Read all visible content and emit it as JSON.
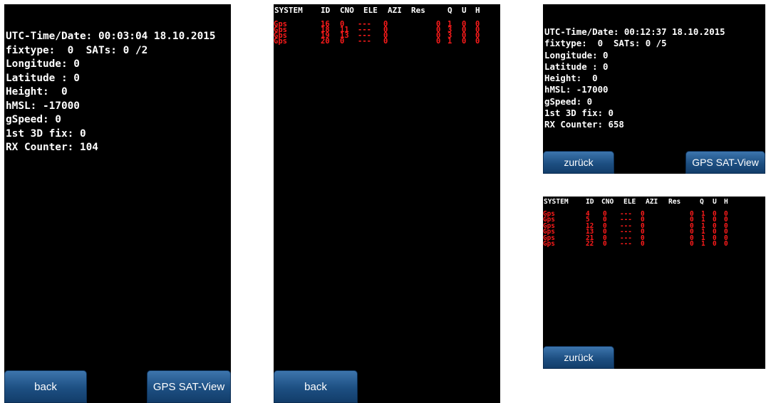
{
  "panel_a": {
    "info_lines": [
      "UTC-Time/Date: 00:03:04 18.10.2015",
      "fixtype:  0  SATs: 0 /2",
      "Longitude: 0",
      "Latitude : 0",
      "Height:  0",
      "hMSL: -17000",
      "gSpeed: 0",
      "1st 3D fix: 0",
      "RX Counter: 104"
    ],
    "back_label": "back",
    "satview_label": "GPS SAT-View"
  },
  "panel_b": {
    "headers": [
      "SYSTEM",
      "ID",
      "CNO",
      "ELE",
      "AZI",
      "Res",
      "Q",
      "U",
      "H"
    ],
    "rows": [
      [
        "Gps",
        "16",
        "0",
        "---",
        "0",
        "0",
        "1",
        "0",
        "0"
      ],
      [
        "Gps",
        "18",
        "11",
        "---",
        "0",
        "0",
        "3",
        "0",
        "0"
      ],
      [
        "Gps",
        "19",
        "13",
        "---",
        "0",
        "0",
        "3",
        "0",
        "0"
      ],
      [
        "Gps",
        "20",
        "0",
        "---",
        "0",
        "0",
        "1",
        "0",
        "0"
      ]
    ],
    "back_label": "back"
  },
  "panel_c": {
    "info_lines": [
      "UTC-Time/Date: 00:12:37 18.10.2015",
      "fixtype:  0  SATs: 0 /5",
      "Longitude: 0",
      "Latitude : 0",
      "Height:  0",
      "hMSL: -17000",
      "gSpeed: 0",
      "1st 3D fix: 0",
      "RX Counter: 658"
    ],
    "back_label": "zurück",
    "satview_label": "GPS SAT-View"
  },
  "panel_d": {
    "headers": [
      "SYSTEM",
      "ID",
      "CNO",
      "ELE",
      "AZI",
      "Res",
      "Q",
      "U",
      "H"
    ],
    "rows": [
      [
        "Gps",
        "4",
        "0",
        "---",
        "0",
        "0",
        "1",
        "0",
        "0"
      ],
      [
        "Gps",
        "5",
        "0",
        "---",
        "0",
        "0",
        "1",
        "0",
        "0"
      ],
      [
        "Gps",
        "12",
        "0",
        "---",
        "0",
        "0",
        "1",
        "0",
        "0"
      ],
      [
        "Gps",
        "13",
        "0",
        "---",
        "0",
        "0",
        "1",
        "0",
        "0"
      ],
      [
        "Gps",
        "21",
        "0",
        "---",
        "0",
        "0",
        "1",
        "0",
        "0"
      ],
      [
        "Gps",
        "22",
        "0",
        "---",
        "0",
        "0",
        "1",
        "0",
        "0"
      ]
    ],
    "back_label": "zurück"
  },
  "colors": {
    "screen_bg": "#000000",
    "text": "#ffffff",
    "satellite_text": "#ff1b1b",
    "button": "#1d4f82"
  }
}
